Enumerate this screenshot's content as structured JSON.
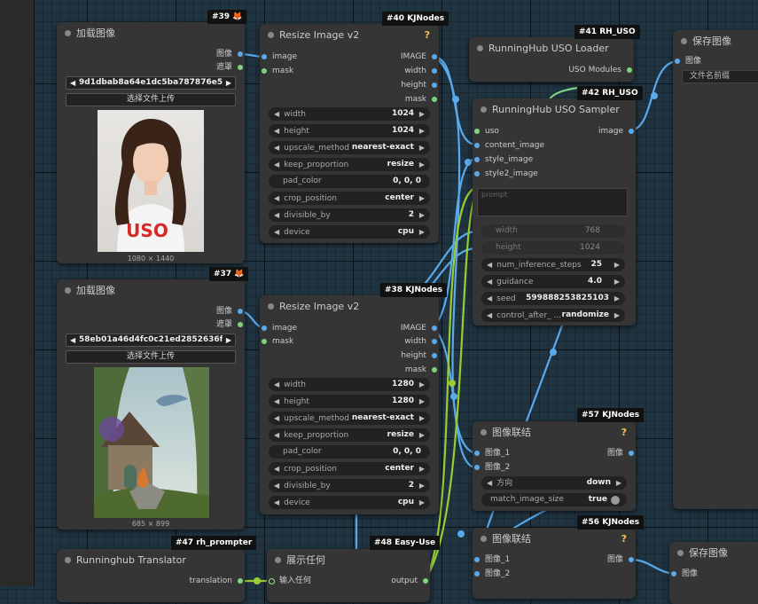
{
  "nodes": {
    "load39": {
      "badge_id": "#39",
      "badge_icon": "🦊",
      "title": "加载图像",
      "out_image": "图像",
      "out_mask": "遮罩",
      "file": "9d1dbab8a64e1dc5ba787876e5 ...",
      "upload": "选择文件上传",
      "dims": "1080 × 1440",
      "img_label": "USO"
    },
    "resize40": {
      "badge": "#40 KJNodes",
      "title": "Resize Image v2",
      "help": "?",
      "in_image": "image",
      "in_mask": "mask",
      "out_image": "IMAGE",
      "out_width": "width",
      "out_height": "height",
      "out_mask": "mask",
      "widgets": [
        {
          "label": "width",
          "value": "1024"
        },
        {
          "label": "height",
          "value": "1024"
        },
        {
          "label": "upscale_method",
          "value": "nearest-exact"
        },
        {
          "label": "keep_proportion",
          "value": "resize"
        },
        {
          "label": "pad_color",
          "value": "0, 0, 0"
        },
        {
          "label": "crop_position",
          "value": "center"
        },
        {
          "label": "divisible_by",
          "value": "2"
        },
        {
          "label": "device",
          "value": "cpu"
        }
      ]
    },
    "loader41": {
      "badge": "#41 RH_USO",
      "title": "RunningHub USO Loader",
      "out_modules": "USO Modules"
    },
    "sampler42": {
      "badge": "#42 RH_USO",
      "title": "RunningHub USO Sampler",
      "in_uso": "uso",
      "in_content": "content_image",
      "in_style": "style_image",
      "in_style2": "style2_image",
      "out_image": "image",
      "prompt_placeholder": "prompt",
      "widgets": [
        {
          "label": "width",
          "value": "768",
          "disabled": true
        },
        {
          "label": "height",
          "value": "1024",
          "disabled": true
        },
        {
          "label": "num_inference_steps",
          "value": "25"
        },
        {
          "label": "guidance",
          "value": "4.0"
        },
        {
          "label": "seed",
          "value": "599888253825103"
        },
        {
          "label": "control_after_ ...",
          "value": "randomize"
        }
      ]
    },
    "save_top": {
      "title": "保存图像",
      "in_image": "图像",
      "prefix": "文件名前缀"
    },
    "load37": {
      "badge_id": "#37",
      "badge_icon": "🦊",
      "title": "加载图像",
      "out_image": "图像",
      "out_mask": "遮罩",
      "file": "58eb01a46d4fc0c21ed2852636f ...",
      "upload": "选择文件上传",
      "dims": "685 × 899"
    },
    "resize38": {
      "badge": "#38 KJNodes",
      "title": "Resize Image v2",
      "in_image": "image",
      "in_mask": "mask",
      "out_image": "IMAGE",
      "out_width": "width",
      "out_height": "height",
      "out_mask": "mask",
      "widgets": [
        {
          "label": "width",
          "value": "1280"
        },
        {
          "label": "height",
          "value": "1280"
        },
        {
          "label": "upscale_method",
          "value": "nearest-exact"
        },
        {
          "label": "keep_proportion",
          "value": "resize"
        },
        {
          "label": "pad_color",
          "value": "0, 0, 0"
        },
        {
          "label": "crop_position",
          "value": "center"
        },
        {
          "label": "divisible_by",
          "value": "2"
        },
        {
          "label": "device",
          "value": "cpu"
        }
      ]
    },
    "concat57": {
      "badge": "#57 KJNodes",
      "title": "图像联结",
      "help": "?",
      "in1": "图像_1",
      "in2": "图像_2",
      "out": "图像",
      "widgets": [
        {
          "label": "方向",
          "value": "down"
        },
        {
          "label": "match_image_size",
          "value": "true"
        }
      ]
    },
    "concat56": {
      "badge": "#56 KJNodes",
      "title": "图像联结",
      "help": "?",
      "in1": "图像_1",
      "in2": "图像_2",
      "out": "图像"
    },
    "save_bottom": {
      "title": "保存图像",
      "in_image": "图像"
    },
    "translator47": {
      "badge": "#47 rh_prompter",
      "title": "Runninghub Translator",
      "out": "translation"
    },
    "show48": {
      "badge": "#48 Easy-Use",
      "title": "展示任何",
      "in": "输入任何",
      "out": "output"
    }
  },
  "colors": {
    "image_wire": "#5aa9ea",
    "string_wire": "#9acd32",
    "canvas": "#1f3341",
    "node": "#353535"
  }
}
